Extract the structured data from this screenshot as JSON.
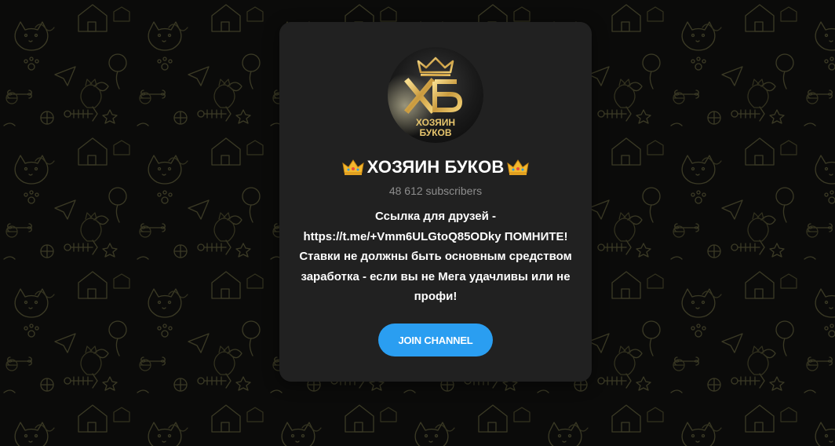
{
  "channel": {
    "title": "ХОЗЯИН БУКОВ",
    "subscribers": "48 612 subscribers",
    "description_lines": [
      "Ссылка для друзей -",
      "https://t.me/+Vmm6ULGtoQ85ODky ПОМНИТЕ!",
      "Ставки не должны быть основным средством",
      "заработка - если вы не Мега удачливы или не",
      "профи!"
    ],
    "avatar": {
      "icon": "crown-logo-icon",
      "monogram": "ХБ",
      "text_line1": "ХОЗЯИН",
      "text_line2": "БУКОВ"
    },
    "title_decoration_icon": "crown-emoji-icon"
  },
  "actions": {
    "join_label": "JOIN CHANNEL"
  },
  "colors": {
    "background": "#0b0b0a",
    "card": "#212121",
    "accent": "#2a9ef1",
    "gold": "#d8b25a",
    "pattern_stroke": "#3a3a26"
  }
}
